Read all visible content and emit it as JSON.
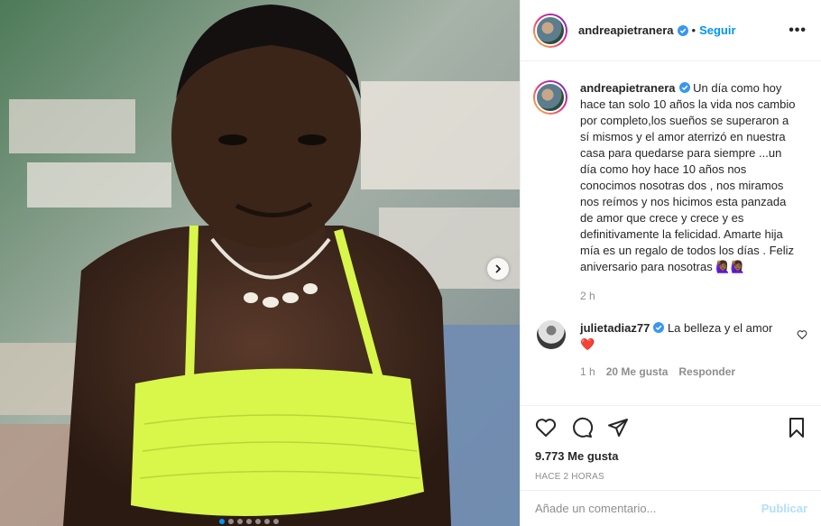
{
  "post": {
    "username": "andreapietranera",
    "follow_label": "Seguir",
    "separator": "•",
    "more_label": "•••",
    "caption": "Un día como hoy hace tan solo 10 años la vida nos cambio por completo,los sueños se superaron a sí mismos y el amor aterrizó en nuestra casa para quedarse para siempre ...un día como hoy hace 10 años nos conocimos nosotras dos , nos miramos nos reímos y nos hicimos esta panzada de amor que crece y crece y es definitivamente la felicidad. Amarte hija mía es un regalo de todos los días . Feliz aniversario para nosotras 🙋🏾‍♀️🙋🏾‍♀️",
    "caption_time": "2 h",
    "likes": "9.773 Me gusta",
    "time_ago": "HACE 2 HORAS"
  },
  "comment": {
    "username": "julietadiaz77",
    "text": "La belleza y el amor ❤️",
    "time": "1 h",
    "likes": "20 Me gusta",
    "reply_label": "Responder"
  },
  "add_comment": {
    "placeholder": "Añade un comentario...",
    "publish_label": "Publicar"
  },
  "carousel": {
    "slide_count": 7,
    "active_index": 0
  },
  "colors": {
    "accent": "#0095f6",
    "verified": "#3897f0",
    "publish_disabled": "#b2dffc",
    "muted": "#8e8e8e",
    "heart": "#ed4956",
    "bikini": "#d9f64a"
  },
  "icons": [
    "verified-badge-icon",
    "more-options-icon",
    "heart-icon",
    "comment-icon",
    "share-icon",
    "bookmark-icon",
    "chevron-right-icon"
  ]
}
